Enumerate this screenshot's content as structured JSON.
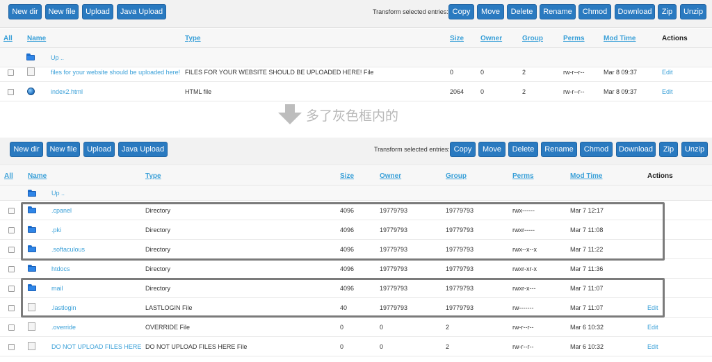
{
  "toolbar": {
    "buttons": [
      "New dir",
      "New file",
      "Upload",
      "Java Upload"
    ],
    "transform_label": "Transform selected entries:",
    "actions": [
      "Copy",
      "Move",
      "Delete",
      "Rename",
      "Chmod",
      "Download",
      "Zip",
      "Unzip"
    ]
  },
  "columns": {
    "all": "All",
    "name": "Name",
    "type": "Type",
    "size": "Size",
    "owner": "Owner",
    "group": "Group",
    "perms": "Perms",
    "mod_time": "Mod Time",
    "actions": "Actions"
  },
  "up_label": "Up ..",
  "panel1": {
    "rows": [
      {
        "name": "files for your website should be uploaded here!",
        "type": "FILES FOR YOUR WEBSITE SHOULD BE UPLOADED HERE! File",
        "size": "0",
        "owner": "0",
        "group": "2",
        "perms": "rw-r--r--",
        "mod_time": "Mar 8 09:37",
        "action": "Edit",
        "icon": "file-icon"
      },
      {
        "name": "index2.html",
        "type": "HTML file",
        "size": "2064",
        "owner": "0",
        "group": "2",
        "perms": "rw-r--r--",
        "mod_time": "Mar 8 09:37",
        "action": "Edit",
        "icon": "html-globe-icon"
      }
    ]
  },
  "caption": "多了灰色框内的",
  "panel2": {
    "rows": [
      {
        "name": ".cpanel",
        "type": "Directory",
        "size": "4096",
        "owner": "19779793",
        "group": "19779793",
        "perms": "rwx------",
        "mod_time": "Mar 7 12:17",
        "action": "",
        "icon": "folder-icon"
      },
      {
        "name": ".pki",
        "type": "Directory",
        "size": "4096",
        "owner": "19779793",
        "group": "19779793",
        "perms": "rwxr-----",
        "mod_time": "Mar 7 11:08",
        "action": "",
        "icon": "folder-icon"
      },
      {
        "name": ".softaculous",
        "type": "Directory",
        "size": "4096",
        "owner": "19779793",
        "group": "19779793",
        "perms": "rwx--x--x",
        "mod_time": "Mar 7 11:22",
        "action": "",
        "icon": "folder-icon"
      },
      {
        "name": "htdocs",
        "type": "Directory",
        "size": "4096",
        "owner": "19779793",
        "group": "19779793",
        "perms": "rwxr-xr-x",
        "mod_time": "Mar 7 11:36",
        "action": "",
        "icon": "folder-icon"
      },
      {
        "name": "mail",
        "type": "Directory",
        "size": "4096",
        "owner": "19779793",
        "group": "19779793",
        "perms": "rwxr-x---",
        "mod_time": "Mar 7 11:07",
        "action": "",
        "icon": "folder-icon"
      },
      {
        "name": ".lastlogin",
        "type": "LASTLOGIN File",
        "size": "40",
        "owner": "19779793",
        "group": "19779793",
        "perms": "rw-------",
        "mod_time": "Mar 7 11:07",
        "action": "Edit",
        "icon": "file-icon"
      },
      {
        "name": ".override",
        "type": "OVERRIDE File",
        "size": "0",
        "owner": "0",
        "group": "2",
        "perms": "rw-r--r--",
        "mod_time": "Mar 6 10:32",
        "action": "Edit",
        "icon": "file-icon"
      },
      {
        "name": "DO NOT UPLOAD FILES HERE",
        "type": "DO NOT UPLOAD FILES HERE File",
        "size": "0",
        "owner": "0",
        "group": "2",
        "perms": "rw-r--r--",
        "mod_time": "Mar 6 10:32",
        "action": "Edit",
        "icon": "file-icon"
      }
    ]
  },
  "colors": {
    "button": "#2a7ac0",
    "link": "#3aa0d8",
    "highlight_border": "#7b7b7b",
    "caption": "#b8b8b8"
  }
}
